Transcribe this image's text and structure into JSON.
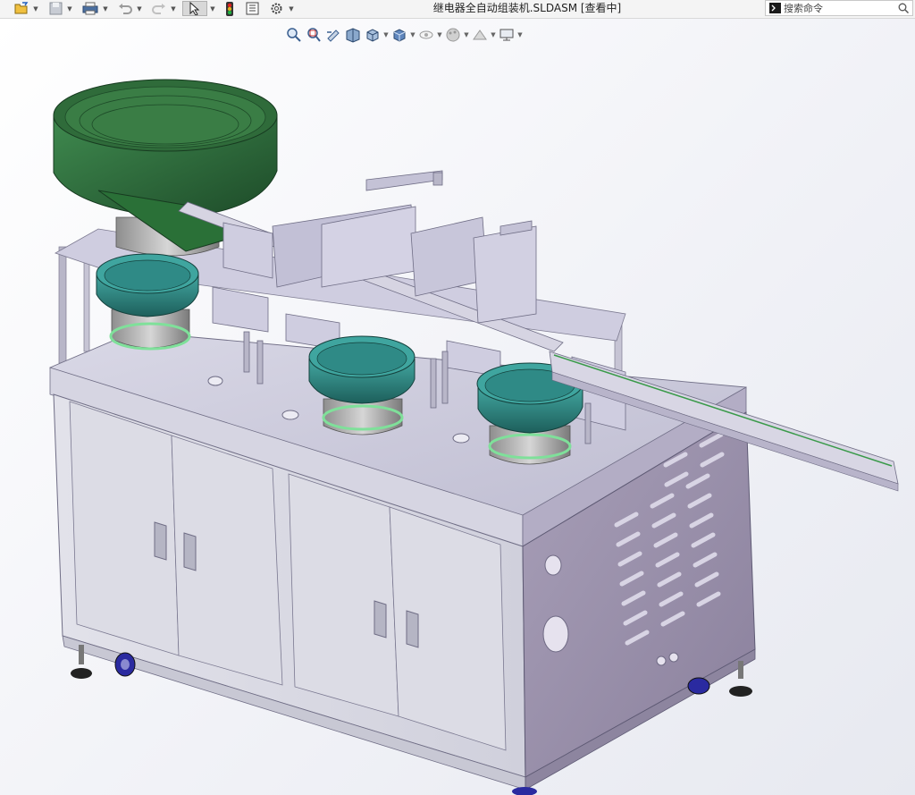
{
  "titlebar": {
    "document_title": "继电器全自动组装机.SLDASM [查看中]",
    "icons": [
      "open-file-icon",
      "save-icon",
      "print-icon",
      "undo-icon",
      "redo-icon",
      "select-arrow-icon",
      "traffic-light-icon",
      "file-properties-icon",
      "options-gear-icon"
    ]
  },
  "search": {
    "placeholder": "搜索命令",
    "value": ""
  },
  "heads_up_toolbar": {
    "icons": [
      "zoom-to-fit-icon",
      "zoom-area-icon",
      "previous-view-icon",
      "section-view-icon",
      "view-orientation-icon",
      "display-style-icon",
      "hide-show-items-icon",
      "edit-appearance-icon",
      "apply-scene-icon",
      "view-settings-icon"
    ]
  },
  "viewport": {
    "model_name": "relay-automatic-assembly-machine",
    "colors": {
      "background_top": "#ffffff",
      "background_bottom": "#e7e9f0",
      "frame": "#c9c7d6",
      "frame_dark": "#a9a6bb",
      "cabinet_side": "#9c93ad",
      "bowl_green": "#2e6b3c",
      "bowl_teal": "#2f8a86",
      "caster_blue": "#2a2aa0"
    }
  }
}
